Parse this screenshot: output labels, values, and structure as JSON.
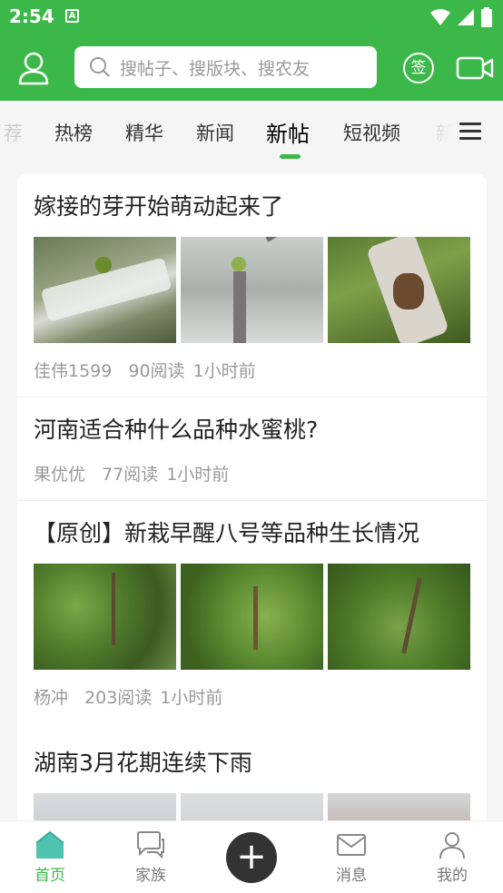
{
  "status": {
    "time": "2:54",
    "badge": "A"
  },
  "header": {
    "search_placeholder": "搜帖子、搜版块、搜农友",
    "sign_label": "签"
  },
  "tabs": [
    {
      "label": "荐"
    },
    {
      "label": "热榜"
    },
    {
      "label": "精华"
    },
    {
      "label": "新闻"
    },
    {
      "label": "新帖"
    },
    {
      "label": "短视频"
    },
    {
      "label": "新"
    }
  ],
  "posts": [
    {
      "title": "嫁接的芽开始萌动起来了",
      "author": "佳伟1599",
      "reads": "90阅读",
      "time": "1小时前",
      "images": [
        "grafted-bud-wrapped",
        "grafted-bud-sprout",
        "grafted-bud-closeup"
      ]
    },
    {
      "title": "河南适合种什么品种水蜜桃?",
      "author": "果优优",
      "reads": "77阅读",
      "time": "1小时前",
      "images": []
    },
    {
      "title": "【原创】新栽早醒八号等品种生长情况",
      "author": "杨冲",
      "reads": "203阅读",
      "time": "1小时前",
      "images": [
        "seedling-grass-1",
        "seedling-grass-2",
        "seedling-grass-3"
      ]
    },
    {
      "title": "湖南3月花期连续下雨",
      "images": [
        "orchard-sky-1",
        "orchard-sky-2",
        "orchard-house"
      ]
    }
  ],
  "bottom_nav": {
    "home": "首页",
    "family": "家族",
    "messages": "消息",
    "mine": "我的"
  },
  "colors": {
    "brand": "#3cb84a"
  }
}
